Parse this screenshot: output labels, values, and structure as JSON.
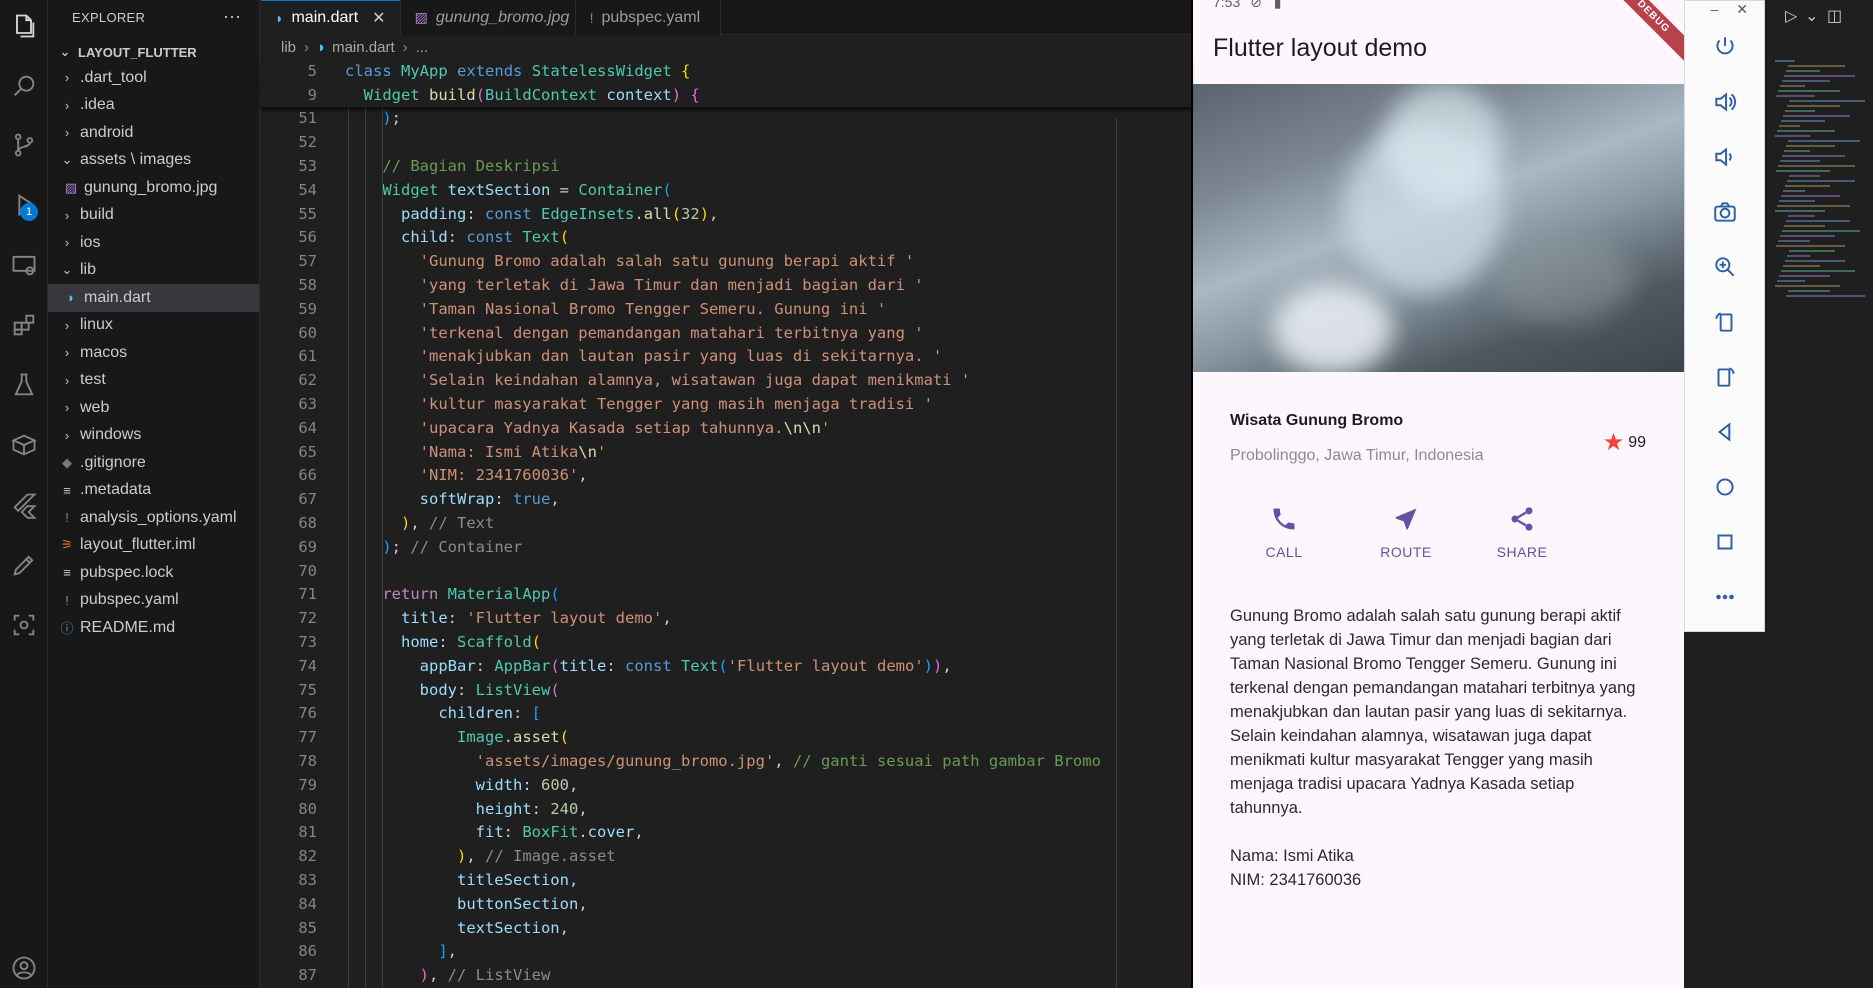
{
  "explorer": {
    "title": "EXPLORER",
    "more": "···",
    "root": "LAYOUT_FLUTTER",
    "items": [
      {
        "label": ".dart_tool",
        "type": "folder",
        "open": false,
        "indent": 1
      },
      {
        "label": ".idea",
        "type": "folder",
        "open": false,
        "indent": 1
      },
      {
        "label": "android",
        "type": "folder",
        "open": false,
        "indent": 1
      },
      {
        "label": "assets \\ images",
        "type": "folder",
        "open": true,
        "indent": 1
      },
      {
        "label": "gunung_bromo.jpg",
        "type": "image",
        "indent": 2
      },
      {
        "label": "build",
        "type": "folder",
        "open": false,
        "indent": 1
      },
      {
        "label": "ios",
        "type": "folder",
        "open": false,
        "indent": 1
      },
      {
        "label": "lib",
        "type": "folder",
        "open": true,
        "indent": 1
      },
      {
        "label": "main.dart",
        "type": "dart",
        "indent": 2,
        "selected": true
      },
      {
        "label": "linux",
        "type": "folder",
        "open": false,
        "indent": 1
      },
      {
        "label": "macos",
        "type": "folder",
        "open": false,
        "indent": 1
      },
      {
        "label": "test",
        "type": "folder",
        "open": false,
        "indent": 1
      },
      {
        "label": "web",
        "type": "folder",
        "open": false,
        "indent": 1
      },
      {
        "label": "windows",
        "type": "folder",
        "open": false,
        "indent": 1
      },
      {
        "label": ".gitignore",
        "type": "git",
        "indent": 1
      },
      {
        "label": ".metadata",
        "type": "meta",
        "indent": 1
      },
      {
        "label": "analysis_options.yaml",
        "type": "yaml",
        "indent": 1
      },
      {
        "label": "layout_flutter.iml",
        "type": "iml",
        "indent": 1
      },
      {
        "label": "pubspec.lock",
        "type": "meta",
        "indent": 1
      },
      {
        "label": "pubspec.yaml",
        "type": "yaml",
        "indent": 1
      },
      {
        "label": "README.md",
        "type": "info",
        "indent": 1
      }
    ]
  },
  "activity": {
    "debug_badge": "1"
  },
  "tabs": [
    {
      "label": "main.dart",
      "active": true,
      "icon": "dart-icon",
      "closable": true
    },
    {
      "label": "gunung_bromo.jpg",
      "active": false,
      "icon": "image-icon",
      "italic": true
    },
    {
      "label": "pubspec.yaml",
      "active": false,
      "icon": "yaml-icon"
    }
  ],
  "breadcrumb": {
    "folder": "lib",
    "file": "main.dart",
    "tail": "..."
  },
  "code": {
    "sticky": [
      {
        "n": "5",
        "html": "<span class=\"kw\">class</span> <span class=\"cls\">MyApp</span> <span class=\"kw\">extends</span> <span class=\"cls\">StatelessWidget</span> <span class=\"br1\">{</span>"
      },
      {
        "n": "9",
        "html": "  <span class=\"cls\">Widget</span> <span class=\"fn\">build</span><span class=\"br2\">(</span><span class=\"cls\">BuildContext</span> <span class=\"prop\">context</span><span class=\"br2\">)</span> <span class=\"br2\">{</span>"
      }
    ],
    "lines": [
      {
        "n": "51",
        "html": "    <span class=\"br3\">)</span>;"
      },
      {
        "n": "52",
        "html": ""
      },
      {
        "n": "53",
        "html": "    <span class=\"cm\">// Bagian Deskripsi</span>"
      },
      {
        "n": "54",
        "html": "    <span class=\"cls\">Widget</span> <span class=\"prop\">textSection</span> = <span class=\"cls\">Container</span><span class=\"br3\">(</span>"
      },
      {
        "n": "55",
        "html": "      <span class=\"prop\">padding</span>: <span class=\"kw\">const</span> <span class=\"cls\">EdgeInsets</span>.<span class=\"fn\">all</span><span class=\"br1\">(</span><span class=\"num\">32</span><span class=\"br1\">)</span>,"
      },
      {
        "n": "56",
        "html": "      <span class=\"prop\">child</span>: <span class=\"kw\">const</span> <span class=\"cls\">Text</span><span class=\"br1\">(</span>"
      },
      {
        "n": "57",
        "html": "        <span class=\"str\">'Gunung Bromo adalah salah satu gunung berapi aktif '</span>"
      },
      {
        "n": "58",
        "html": "        <span class=\"str\">'yang terletak di Jawa Timur dan menjadi bagian dari '</span>"
      },
      {
        "n": "59",
        "html": "        <span class=\"str\">'Taman Nasional Bromo Tengger Semeru. Gunung ini '</span>"
      },
      {
        "n": "60",
        "html": "        <span class=\"str\">'terkenal dengan pemandangan matahari terbitnya yang '</span>"
      },
      {
        "n": "61",
        "html": "        <span class=\"str\">'menakjubkan dan lautan pasir yang luas di sekitarnya. '</span>"
      },
      {
        "n": "62",
        "html": "        <span class=\"str\">'Selain keindahan alamnya, wisatawan juga dapat menikmati '</span>"
      },
      {
        "n": "63",
        "html": "        <span class=\"str\">'kultur masyarakat Tengger yang masih menjaga tradisi '</span>"
      },
      {
        "n": "64",
        "html": "        <span class=\"str\">'upacara Yadnya Kasada setiap tahunnya.</span><span class=\"fn\">\\n\\n</span><span class=\"str\">'</span>"
      },
      {
        "n": "65",
        "html": "        <span class=\"str\">'Nama: Ismi Atika</span><span class=\"fn\">\\n</span><span class=\"str\">'</span>"
      },
      {
        "n": "66",
        "html": "        <span class=\"str\">'NIM: 2341760036'</span>,"
      },
      {
        "n": "67",
        "html": "        <span class=\"prop\">softWrap</span>: <span class=\"kw\">true</span>,"
      },
      {
        "n": "68",
        "html": "      <span class=\"br1\">)</span>, <span class=\"cm\" style=\"color:#8b8b8b\">// Text</span>"
      },
      {
        "n": "69",
        "html": "    <span class=\"br3\">)</span>; <span class=\"cm\" style=\"color:#8b8b8b\">// Container</span>"
      },
      {
        "n": "70",
        "html": ""
      },
      {
        "n": "71",
        "html": "    <span class=\"kw2\">return</span> <span class=\"cls\">MaterialApp</span><span class=\"br3\">(</span>"
      },
      {
        "n": "72",
        "html": "      <span class=\"prop\">title</span>: <span class=\"str\">'Flutter layout demo'</span>,"
      },
      {
        "n": "73",
        "html": "      <span class=\"prop\">home</span>: <span class=\"cls\">Scaffold</span><span class=\"br1\">(</span>"
      },
      {
        "n": "74",
        "html": "        <span class=\"prop\">appBar</span>: <span class=\"cls\">AppBar</span><span class=\"br2\">(</span><span class=\"prop\">title</span>: <span class=\"kw\">const</span> <span class=\"cls\">Text</span><span class=\"br3\">(</span><span class=\"str\">'Flutter layout demo'</span><span class=\"br3\">)</span><span class=\"br2\">)</span>,"
      },
      {
        "n": "75",
        "html": "        <span class=\"prop\">body</span>: <span class=\"cls\">ListView</span><span class=\"br2\">(</span>"
      },
      {
        "n": "76",
        "html": "          <span class=\"prop\">children</span>: <span class=\"br3\">[</span>"
      },
      {
        "n": "77",
        "html": "            <span class=\"cls\">Image</span>.<span class=\"fn\">asset</span><span class=\"br1\">(</span>"
      },
      {
        "n": "78",
        "html": "              <span class=\"str\">'assets/images/gunung_bromo.jpg'</span>, <span class=\"cm\">// ganti sesuai path gambar Bromo</span>"
      },
      {
        "n": "79",
        "html": "              <span class=\"prop\">width</span>: <span class=\"num\">600</span>,"
      },
      {
        "n": "80",
        "html": "              <span class=\"prop\">height</span>: <span class=\"num\">240</span>,"
      },
      {
        "n": "81",
        "html": "              <span class=\"prop\">fit</span>: <span class=\"cls\">BoxFit</span>.<span class=\"prop\">cover</span>,"
      },
      {
        "n": "82",
        "html": "            <span class=\"br1\">)</span>, <span class=\"cm\" style=\"color:#8b8b8b\">// Image.asset</span>"
      },
      {
        "n": "83",
        "html": "            <span class=\"prop\">titleSection</span>,"
      },
      {
        "n": "84",
        "html": "            <span class=\"prop\">buttonSection</span>,"
      },
      {
        "n": "85",
        "html": "            <span class=\"prop\">textSection</span>,"
      },
      {
        "n": "86",
        "html": "          <span class=\"br3\">]</span>,"
      },
      {
        "n": "87",
        "html": "        <span class=\"br2\">)</span>, <span class=\"cm\" style=\"color:#8b8b8b\">// ListView</span>"
      }
    ]
  },
  "phone": {
    "status_time": "7:53",
    "debug_banner": "DEBUG",
    "appbar_title": "Flutter layout demo",
    "title": "Wisata Gunung Bromo",
    "subtitle": "Probolinggo, Jawa Timur, Indonesia",
    "rating": "99",
    "buttons": [
      {
        "label": "CALL",
        "icon": "phone-icon"
      },
      {
        "label": "ROUTE",
        "icon": "navigation-icon"
      },
      {
        "label": "SHARE",
        "icon": "share-icon"
      }
    ],
    "description": "Gunung Bromo adalah salah satu gunung berapi aktif yang terletak di Jawa Timur dan menjadi bagian dari Taman Nasional Bromo Tengger Semeru. Gunung ini terkenal dengan pemandangan matahari terbitnya yang menakjubkan dan lautan pasir yang luas di sekitarnya. Selain keindahan alamnya, wisatawan juga dapat menikmati kultur masyarakat Tengger yang masih menjaga tradisi upacara Yadnya Kasada setiap tahunnya.\n\nNama: Ismi Atika\nNIM: 2341760036",
    "accent": "#6750a4",
    "star_color": "#f44336"
  },
  "emulator": {
    "minimize": "–",
    "close": "✕",
    "controls": [
      "power-icon",
      "volume-up-icon",
      "volume-down-icon",
      "camera-icon",
      "zoom-icon",
      "rotate-left-icon",
      "rotate-right-icon",
      "back-icon",
      "home-icon",
      "overview-icon",
      "more-icon"
    ]
  },
  "colors": {
    "vscode_bg": "#1f1f1f",
    "sidebar_bg": "#181818",
    "selection": "#37373d",
    "vscode_accent": "#0078d4"
  }
}
